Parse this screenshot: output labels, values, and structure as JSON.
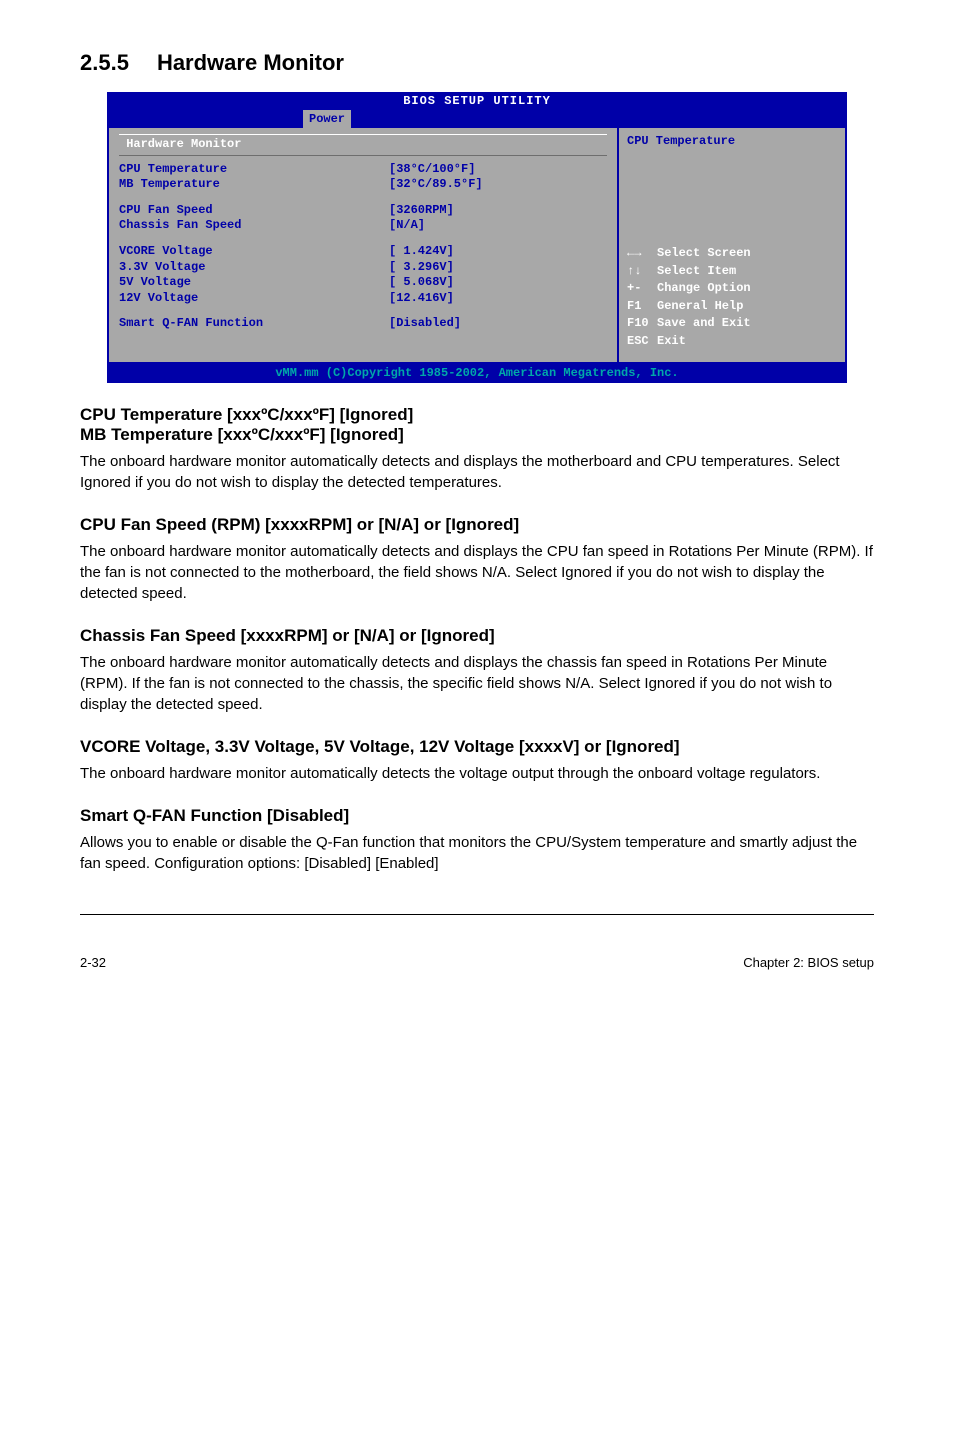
{
  "section": {
    "number": "2.5.5",
    "title": "Hardware Monitor"
  },
  "bios": {
    "utility_title": "BIOS SETUP UTILITY",
    "tab": "Power",
    "panel_header": "Hardware Monitor",
    "rows": {
      "cpu_temp_label": "CPU Temperature",
      "cpu_temp_val": "[38°C/100°F]",
      "mb_temp_label": "MB Temperature",
      "mb_temp_val": "[32°C/89.5°F]",
      "cpu_fan_label": "CPU Fan Speed",
      "cpu_fan_val": "[3260RPM]",
      "chassis_fan_label": "Chassis Fan Speed",
      "chassis_fan_val": "[N/A]",
      "vcore_label": "VCORE Voltage",
      "vcore_val": "[ 1.424V]",
      "v33_label": "3.3V Voltage",
      "v33_val": "[ 3.296V]",
      "v5_label": "5V Voltage",
      "v5_val": "[ 5.068V]",
      "v12_label": "12V Voltage",
      "v12_val": "[12.416V]",
      "qfan_label": "Smart Q-FAN Function",
      "qfan_val": "[Disabled]"
    },
    "help_title": "CPU Temperature",
    "hints": {
      "h1_sym": "←→",
      "h1_txt": "Select Screen",
      "h2_sym": "↑↓",
      "h2_txt": "Select Item",
      "h3_sym": "+-",
      "h3_txt": "Change Option",
      "h4_sym": "F1",
      "h4_txt": "General Help",
      "h5_sym": "F10",
      "h5_txt": "Save and Exit",
      "h6_sym": "ESC",
      "h6_txt": "Exit"
    },
    "footer": "vMM.mm (C)Copyright 1985-2002, American Megatrends, Inc."
  },
  "sections": {
    "cpu_mb_temp": {
      "heading_line1": "CPU Temperature [xxxºC/xxxºF] [Ignored]",
      "heading_line2": "MB Temperature [xxxºC/xxxºF] [Ignored]",
      "body": "The onboard hardware monitor automatically detects and displays the motherboard and CPU temperatures. Select Ignored if you do not wish to display the detected temperatures."
    },
    "cpu_fan": {
      "heading": "CPU Fan Speed (RPM) [xxxxRPM] or [N/A] or [Ignored]",
      "body": "The onboard hardware monitor automatically detects and displays the CPU fan speed in Rotations Per Minute (RPM). If the fan is not connected to the motherboard, the field shows N/A. Select Ignored if you do not wish to display the detected speed."
    },
    "chassis_fan": {
      "heading": "Chassis Fan Speed [xxxxRPM] or [N/A] or [Ignored]",
      "body": "The onboard hardware monitor automatically detects and displays the chassis fan speed in Rotations Per Minute (RPM). If the fan is not connected to the chassis, the specific field shows N/A. Select Ignored if you do not wish to display the detected speed."
    },
    "voltage": {
      "heading": "VCORE Voltage, 3.3V Voltage, 5V Voltage, 12V Voltage [xxxxV] or [Ignored]",
      "body": "The onboard hardware monitor automatically detects the voltage output through the onboard voltage regulators."
    },
    "qfan": {
      "heading": "Smart Q-FAN Function [Disabled]",
      "body": "Allows you to enable or disable the Q-Fan function that monitors the CPU/System temperature and smartly adjust the fan speed. Configuration options: [Disabled] [Enabled]"
    }
  },
  "footer": {
    "left": "2-32",
    "right": "Chapter 2: BIOS setup"
  }
}
